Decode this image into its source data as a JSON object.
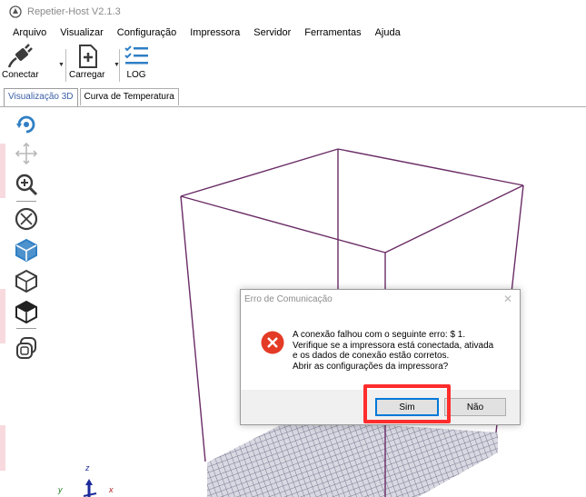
{
  "window": {
    "title": "Repetier-Host V2.1.3"
  },
  "menu": [
    "Arquivo",
    "Visualizar",
    "Configuração",
    "Impressora",
    "Servidor",
    "Ferramentas",
    "Ajuda"
  ],
  "toolbar": {
    "connect_label": "Conectar",
    "load_label": "Carregar",
    "log_label": "LOG"
  },
  "tabs": [
    {
      "label": "Visualização 3D",
      "active": true
    },
    {
      "label": "Curva de Temperatura",
      "active": false
    }
  ],
  "sidebar_tools": [
    "rotate-view-icon",
    "move-view-icon",
    "zoom-icon",
    "fit-to-view-icon",
    "isometric-view-icon",
    "front-view-icon",
    "top-view-icon",
    "toggle-objects-icon"
  ],
  "dialog": {
    "title": "Erro de Comunicação",
    "close_glyph": "✕",
    "message_lines": [
      "A conexão falhou com o seguinte erro: $ 1.",
      "Verifique se a impressora está conectada, ativada",
      "e os dados de conexão estão corretos.",
      "Abrir as configurações da impressora?"
    ],
    "yes_label": "Sim",
    "no_label": "Não"
  },
  "axes": {
    "z": "z",
    "y": "y",
    "x": "x"
  },
  "colors": {
    "accent": "#2f7fc4",
    "frame_line": "#6a2c66",
    "grid": "#7a7890",
    "error_icon": "#e43b26",
    "highlight": "#ff2d2d"
  }
}
